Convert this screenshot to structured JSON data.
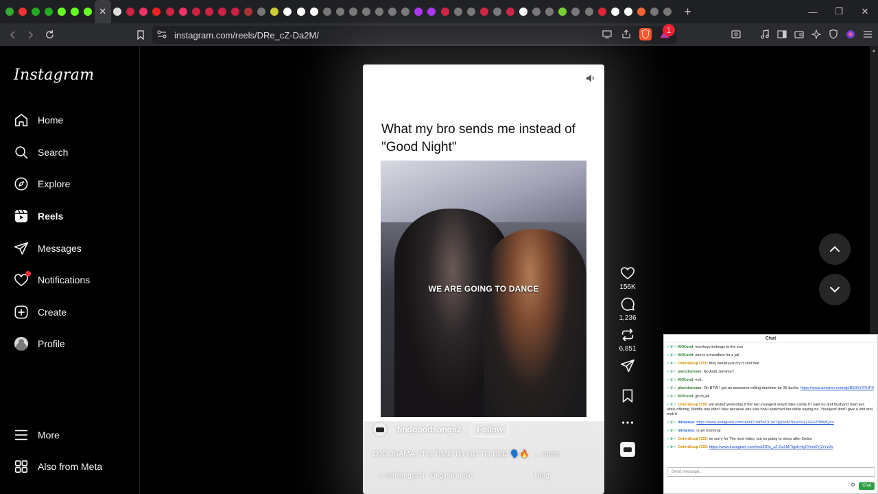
{
  "browser": {
    "tab_colors": [
      "#3a3",
      "#e33",
      "#2a2",
      "#2a2",
      "#6f2",
      "#6f2",
      "#6f2",
      "#ddd",
      "#c24",
      "#e36",
      "#e22",
      "#c24",
      "#e36",
      "#c24",
      "#c24",
      "#c24",
      "#c24",
      "#a33",
      "#777",
      "#cc3",
      "#fff",
      "#fff",
      "#fff",
      "#777",
      "#777",
      "#777",
      "#777",
      "#777",
      "#777",
      "#777",
      "#a3e",
      "#a3e",
      "#c24",
      "#777",
      "#777",
      "#c24",
      "#777",
      "#c24",
      "#fff",
      "#777",
      "#777",
      "#7c3",
      "#777",
      "#777",
      "#d23",
      "#fff",
      "#fff",
      "#e63",
      "#777",
      "#777"
    ],
    "active_tab_close": "✕",
    "new_tab": "+",
    "url": "instagram.com/reels/DRe_cZ-Da2M/",
    "rewards_badge": "1"
  },
  "sidebar": {
    "logo": "Instagram",
    "items": [
      {
        "label": "Home",
        "icon": "home-icon"
      },
      {
        "label": "Search",
        "icon": "search-icon"
      },
      {
        "label": "Explore",
        "icon": "compass-icon"
      },
      {
        "label": "Reels",
        "icon": "reels-icon"
      },
      {
        "label": "Messages",
        "icon": "send-icon"
      },
      {
        "label": "Notifications",
        "icon": "heart-icon"
      },
      {
        "label": "Create",
        "icon": "plus-square-icon"
      },
      {
        "label": "Profile",
        "icon": "avatar"
      }
    ],
    "more": "More",
    "meta": "Also from Meta"
  },
  "reel": {
    "caption": "What my bro sends me instead of \"Good Night\"",
    "overlay": "WE ARE GOING TO DANCE",
    "username": "findgoodsongs2",
    "follow": "Follow",
    "description": "OJOUSAMA, IT'S TIME TO GO TO BED 🗣️🔥",
    "more": "... more",
    "audio": "oodsongs2.0 · Original audio",
    "audio_right": "findg",
    "likes": "156K",
    "comments": "1,236",
    "reposts": "6,851"
  },
  "chat": {
    "title": "Chat",
    "messages": [
      {
        "user": "KKKontl",
        "color": "#2e7d32",
        "text": "monkeys belongs to the zoo"
      },
      {
        "user": "KKKontl",
        "color": "#2e7d32",
        "text": "zoo is a metafora for a jail"
      },
      {
        "user": "OnionSoup7155",
        "color": "#d68a00",
        "text": "they would just cry if i did that"
      },
      {
        "user": "placidstream",
        "color": "#3a7d3a",
        "text": "No Aunt Jemima?"
      },
      {
        "user": "KKKontl",
        "color": "#2e7d32",
        "text": "evil.."
      },
      {
        "user": "placidstream",
        "color": "#3a7d3a",
        "text": "Oh BTW I got an awesome rolling machine for 25 bucks.",
        "link": "https://www.amazon.com/dp/B0D6Y3THP9"
      },
      {
        "user": "KKKontl",
        "color": "#2e7d32",
        "text": "go to jail"
      },
      {
        "user": "OnionSoup7155",
        "color": "#d68a00",
        "text": "we tested yesterday if the two youngest would take candy if I said no and husband Said yes while offering. Middle one didn't take because she saw how i watched her while saying no. Youngest didn't give a shit and took it"
      },
      {
        "user": "niinanise",
        "color": "#1e5fd6",
        "text": "",
        "link": "https://www.instagram.com/reel/DTfah5vDCre/?igsh=MThuenV4ZGFoZ3BlMQ=="
      },
      {
        "user": "niinanise",
        "color": "#1e5fd6",
        "text": "cruel mommal"
      },
      {
        "user": "OnionSoup7155",
        "color": "#d68a00",
        "text": "im sorry for The next video, but im going to sleep after 5mins"
      },
      {
        "user": "OnionSoup7155",
        "color": "#d68a00",
        "text": "",
        "link": "https://www.instagram.com/reel/DRe_cZ-Da2M/?igsh=djJtYmk0YjZrYzZs"
      }
    ],
    "placeholder": "Send message...",
    "send": "Chat"
  }
}
